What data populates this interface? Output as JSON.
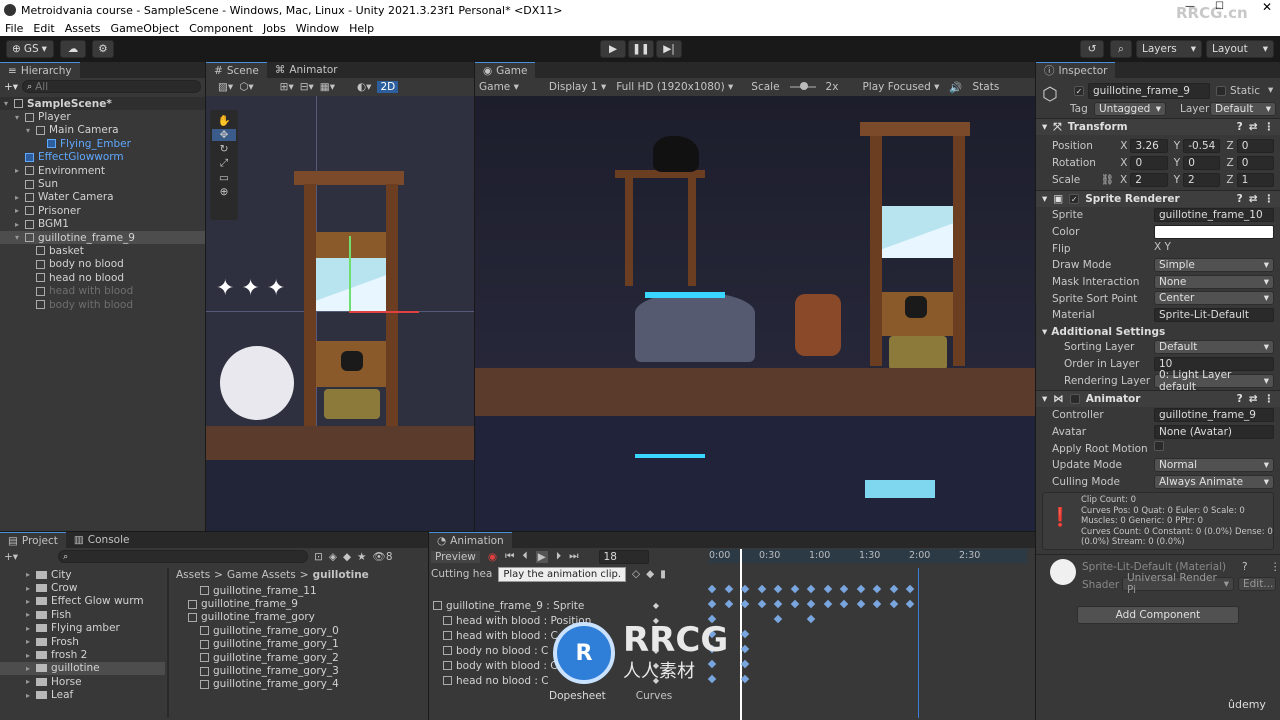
{
  "window": {
    "title": "Metroidvania course - SampleScene - Windows, Mac, Linux - Unity 2021.3.23f1 Personal* <DX11>",
    "watermark": "RRCG.cn"
  },
  "menu": [
    "File",
    "Edit",
    "Assets",
    "GameObject",
    "Component",
    "Jobs",
    "Window",
    "Help"
  ],
  "toolbar": {
    "account": "GS",
    "layers": "Layers",
    "layout": "Layout"
  },
  "hierarchy": {
    "tab": "Hierarchy",
    "search": "All",
    "items": [
      {
        "label": "SampleScene*",
        "depth": 0,
        "style": "scene"
      },
      {
        "label": "Player",
        "depth": 1,
        "style": ""
      },
      {
        "label": "Main Camera",
        "depth": 2,
        "style": ""
      },
      {
        "label": "Flying_Ember",
        "depth": 3,
        "style": "blue"
      },
      {
        "label": "EffectGlowworm",
        "depth": 1,
        "style": "blue"
      },
      {
        "label": "Environment",
        "depth": 1,
        "style": ""
      },
      {
        "label": "Sun",
        "depth": 1,
        "style": ""
      },
      {
        "label": "Water Camera",
        "depth": 1,
        "style": ""
      },
      {
        "label": "Prisoner",
        "depth": 1,
        "style": ""
      },
      {
        "label": "BGM1",
        "depth": 1,
        "style": ""
      },
      {
        "label": "guillotine_frame_9",
        "depth": 1,
        "style": "selected"
      },
      {
        "label": "basket",
        "depth": 2,
        "style": ""
      },
      {
        "label": "body no blood",
        "depth": 2,
        "style": ""
      },
      {
        "label": "head no blood",
        "depth": 2,
        "style": ""
      },
      {
        "label": "head with blood",
        "depth": 2,
        "style": "dim"
      },
      {
        "label": "body with blood",
        "depth": 2,
        "style": "dim"
      }
    ]
  },
  "scene": {
    "tab_scene": "Scene",
    "tab_animator": "Animator",
    "mode2d": "2D"
  },
  "game": {
    "tab": "Game",
    "view": "Game",
    "display": "Display 1",
    "resolution": "Full HD (1920x1080)",
    "scale_label": "Scale",
    "scale_value": "2x",
    "play_focused": "Play Focused",
    "stats": "Stats"
  },
  "inspector": {
    "tab": "Inspector",
    "object_name": "guillotine_frame_9",
    "static": "Static",
    "tag_label": "Tag",
    "tag": "Untagged",
    "layer_label": "Layer",
    "layer": "Default",
    "transform": {
      "title": "Transform",
      "position_label": "Position",
      "rotation_label": "Rotation",
      "scale_label": "Scale",
      "position": [
        "3.26",
        "-0.54",
        "0"
      ],
      "rotation": [
        "0",
        "0",
        "0"
      ],
      "scale": [
        "2",
        "2",
        "1"
      ]
    },
    "sprite_renderer": {
      "title": "Sprite Renderer",
      "rows": [
        {
          "label": "Sprite",
          "value": "guillotine_frame_10"
        },
        {
          "label": "Color",
          "value": ""
        },
        {
          "label": "Flip",
          "value": "X   Y"
        },
        {
          "label": "Draw Mode",
          "value": "Simple"
        },
        {
          "label": "Mask Interaction",
          "value": "None"
        },
        {
          "label": "Sprite Sort Point",
          "value": "Center"
        },
        {
          "label": "Material",
          "value": "Sprite-Lit-Default"
        }
      ],
      "additional": "Additional Settings",
      "sorting_layer_label": "Sorting Layer",
      "sorting_layer": "Default",
      "order_label": "Order in Layer",
      "order": "10",
      "rendering_label": "Rendering Layer M",
      "rendering": "0: Light Layer default"
    },
    "animator": {
      "title": "Animator",
      "rows": [
        {
          "label": "Controller",
          "value": "guillotine_frame_9"
        },
        {
          "label": "Avatar",
          "value": "None (Avatar)"
        },
        {
          "label": "Apply Root Motion",
          "value": ""
        },
        {
          "label": "Update Mode",
          "value": "Normal"
        },
        {
          "label": "Culling Mode",
          "value": "Always Animate"
        }
      ],
      "info": [
        "Clip Count: 0",
        "Curves Pos: 0 Quat: 0 Euler: 0 Scale: 0",
        "Muscles: 0 Generic: 0 PPtr: 0",
        "Curves Count: 0 Constant: 0 (0.0%) Dense: 0",
        "(0.0%) Stream: 0 (0.0%)"
      ]
    },
    "material": {
      "name": "Sprite-Lit-Default (Material)",
      "shader_label": "Shader",
      "shader": "Universal Render Pi",
      "edit": "Edit..."
    },
    "add_component": "Add Component"
  },
  "project": {
    "tab_project": "Project",
    "tab_console": "Console",
    "count": "8",
    "folders": [
      "City",
      "Crow",
      "Effect Glow wurm",
      "Fish",
      "Flying amber",
      "Frosh",
      "frosh 2",
      "guillotine",
      "Horse",
      "Leaf"
    ],
    "breadcrumb": [
      "Assets",
      "Game Assets",
      "guillotine"
    ],
    "files": [
      "guillotine_frame_11",
      "guillotine_frame_9",
      "guillotine_frame_gory",
      "guillotine_frame_gory_0",
      "guillotine_frame_gory_1",
      "guillotine_frame_gory_2",
      "guillotine_frame_gory_3",
      "guillotine_frame_gory_4"
    ]
  },
  "animation": {
    "tab": "Animation",
    "preview": "Preview",
    "frame": "18",
    "clip": "Cutting hea",
    "tooltip": "Play the animation clip.",
    "ticks": [
      "0:00",
      "0:30",
      "1:00",
      "1:30",
      "2:00",
      "2:30"
    ],
    "properties": [
      "guillotine_frame_9 : Sprite",
      "head with blood : Position",
      "head with blood : C",
      "body no blood : C",
      "body with blood : C",
      "head no blood : C"
    ],
    "dopesheet": "Dopesheet",
    "curves": "Curves"
  },
  "overlay": {
    "logo_text": "RRCG",
    "logo_sub": "人人素材",
    "udemy": "ûdemy"
  }
}
